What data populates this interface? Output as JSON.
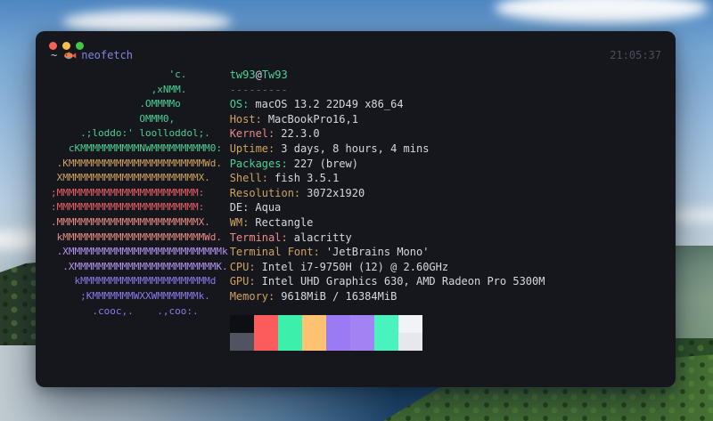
{
  "theme": {
    "green": "#4ad295",
    "gold": "#cfa35f",
    "red": "#ed5f68",
    "salmon": "#ea8c87",
    "lavender": "#b295f0",
    "purple": "#8d7aea",
    "fg": "#d6d8e0",
    "grey": "#5c606c",
    "dim": "#4b4f5a",
    "tilde": "#c9cbd4",
    "command": "#8085dc"
  },
  "window": {
    "traffic_lights": [
      "#f6615a",
      "#f9bd4b",
      "#43c645"
    ],
    "prompt": {
      "cwd": "~",
      "command": "neofetch",
      "time": "21:05:37"
    },
    "neofetch": {
      "ascii_lines": [
        {
          "text": "                    'c.",
          "color": "green"
        },
        {
          "text": "                 ,xNMM.",
          "color": "green"
        },
        {
          "text": "               .OMMMMo",
          "color": "green"
        },
        {
          "text": "               OMMM0,",
          "color": "green"
        },
        {
          "text": "     .;loddo:' loolloddol;.",
          "color": "green"
        },
        {
          "text": "   cKMMMMMMMMMMNWMMMMMMMMMM0:",
          "color": "green"
        },
        {
          "text": " .KMMMMMMMMMMMMMMMMMMMMMMMWd.",
          "color": "gold"
        },
        {
          "text": " XMMMMMMMMMMMMMMMMMMMMMMMX.",
          "color": "gold"
        },
        {
          "text": ";MMMMMMMMMMMMMMMMMMMMMMMM:",
          "color": "red"
        },
        {
          "text": ":MMMMMMMMMMMMMMMMMMMMMMMM:",
          "color": "red"
        },
        {
          "text": ".MMMMMMMMMMMMMMMMMMMMMMMMX.",
          "color": "salmon"
        },
        {
          "text": " kMMMMMMMMMMMMMMMMMMMMMMMMWd.",
          "color": "salmon"
        },
        {
          "text": " .XMMMMMMMMMMMMMMMMMMMMMMMMMMk",
          "color": "lavender"
        },
        {
          "text": "  .XMMMMMMMMMMMMMMMMMMMMMMMMK.",
          "color": "lavender"
        },
        {
          "text": "    kMMMMMMMMMMMMMMMMMMMMMMd",
          "color": "purple"
        },
        {
          "text": "     ;KMMMMMMMWXXWMMMMMMMk.",
          "color": "purple"
        },
        {
          "text": "       .cooc,.    .,coo:.",
          "color": "purple"
        }
      ],
      "title": {
        "user": "tw93",
        "at": "@",
        "host": "Tw93"
      },
      "separator": "---------",
      "info": [
        {
          "label": "OS:",
          "value": "macOS 13.2 22D49 x86_64",
          "color": "green"
        },
        {
          "label": "Host:",
          "value": "MacBookPro16,1",
          "color": "gold"
        },
        {
          "label": "Kernel:",
          "value": "22.3.0",
          "color": "salmon"
        },
        {
          "label": "Uptime:",
          "value": "3 days, 8 hours, 4 mins",
          "color": "gold"
        },
        {
          "label": "Packages:",
          "value": "227 (brew)",
          "color": "green"
        },
        {
          "label": "Shell:",
          "value": "fish 3.5.1",
          "color": "gold"
        },
        {
          "label": "Resolution:",
          "value": "3072x1920",
          "color": "gold"
        },
        {
          "label": "DE:",
          "value": "Aqua",
          "color": "fg"
        },
        {
          "label": "WM:",
          "value": "Rectangle",
          "color": "gold"
        },
        {
          "label": "Terminal:",
          "value": "alacritty",
          "color": "salmon"
        },
        {
          "label": "Terminal Font:",
          "value": "'JetBrains Mono'",
          "color": "gold"
        },
        {
          "label": "CPU:",
          "value": "Intel i7-9750H (12) @ 2.60GHz",
          "color": "gold"
        },
        {
          "label": "GPU:",
          "value": "Intel UHD Graphics 630, AMD Radeon Pro 5300M",
          "color": "gold"
        },
        {
          "label": "Memory:",
          "value": "9618MiB / 16384MiB",
          "color": "gold"
        }
      ],
      "palette": {
        "row1": [
          "#0e0f15",
          "#fc5c5c",
          "#3cf0ab",
          "#fec272",
          "#9b7bf3",
          "#a383f3",
          "#4af2bd",
          "#f2f3f7"
        ],
        "row2": [
          "#515460",
          "#fc5c5c",
          "#3cf0ab",
          "#fec272",
          "#9b7bf3",
          "#a383f3",
          "#4af2bd",
          "#e6e8ee"
        ]
      }
    }
  }
}
